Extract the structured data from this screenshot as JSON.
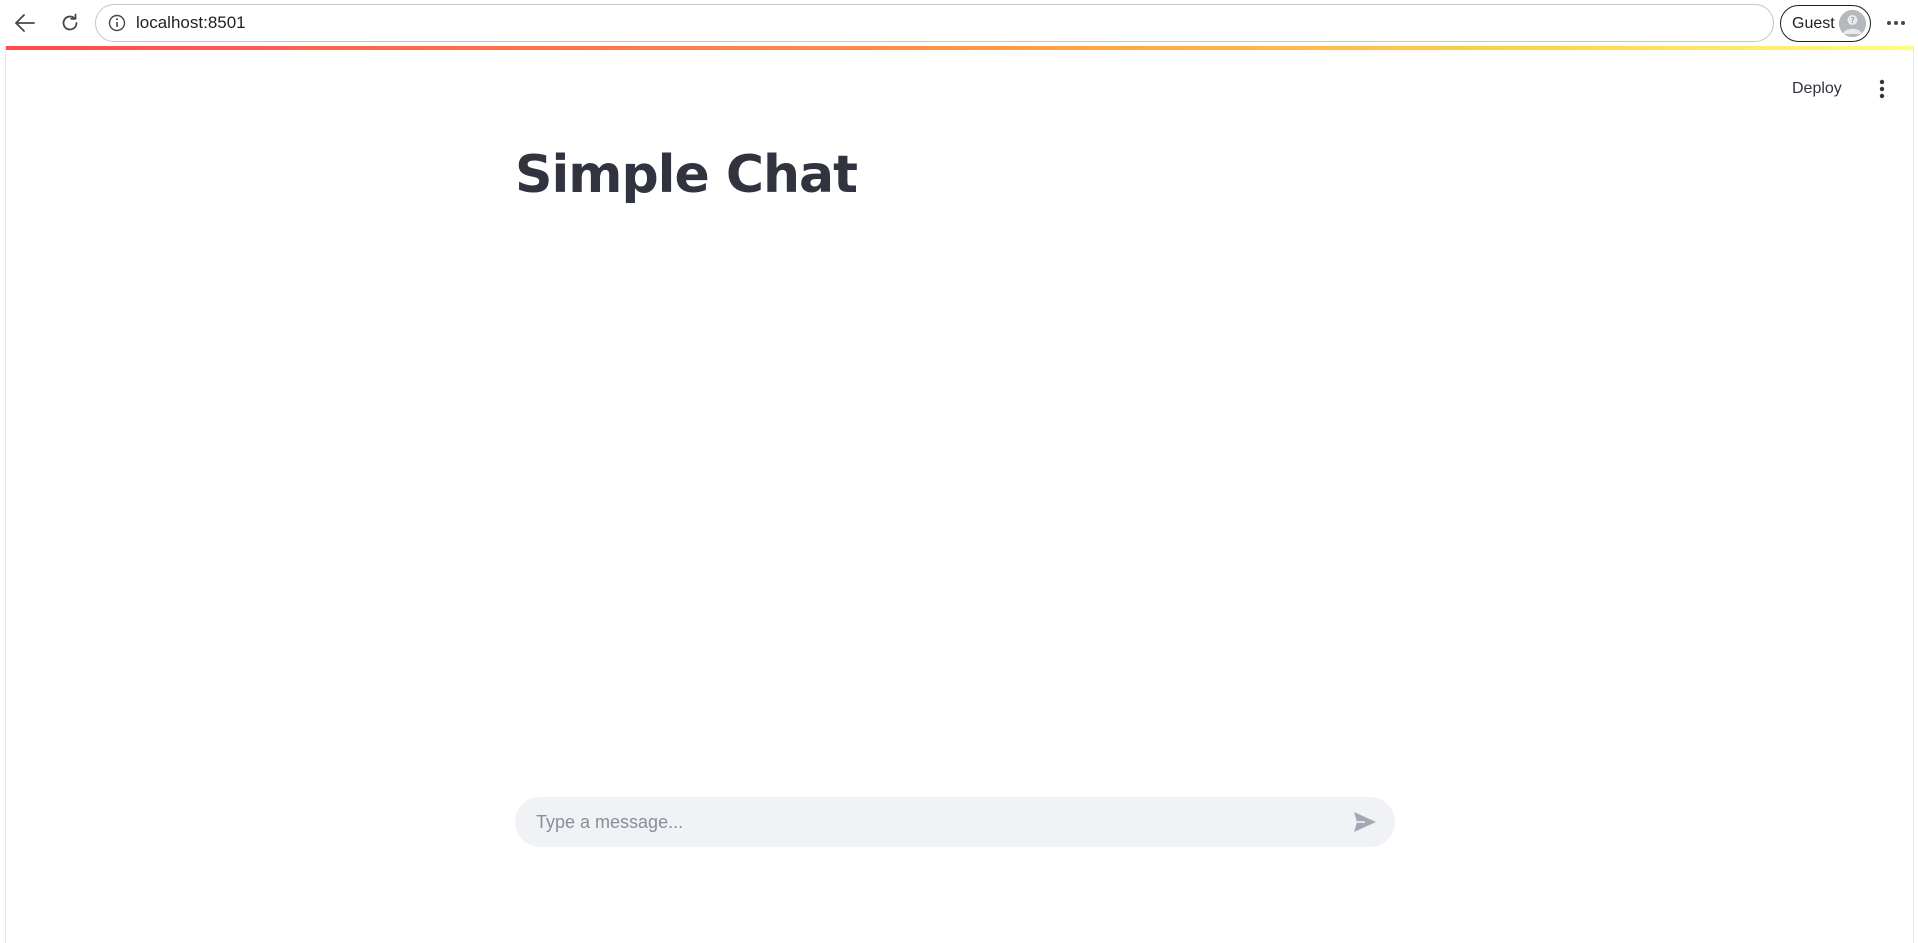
{
  "browser": {
    "url": "localhost:8501",
    "profile_label": "Guest"
  },
  "app": {
    "deploy_label": "Deploy",
    "title": "Simple Chat"
  },
  "chat": {
    "placeholder": "Type a message...",
    "value": ""
  },
  "icons": {
    "back": "arrow-left-icon",
    "reload": "reload-icon",
    "site_info": "info-icon",
    "avatar": "guest-avatar-icon",
    "browser_menu": "more-horizontal-icon",
    "app_menu": "more-vertical-icon",
    "send": "send-icon"
  },
  "colors": {
    "accent_red": "#ff4b4b",
    "text": "#31333f",
    "input_bg": "#f0f2f6",
    "placeholder": "#8a8d97"
  }
}
